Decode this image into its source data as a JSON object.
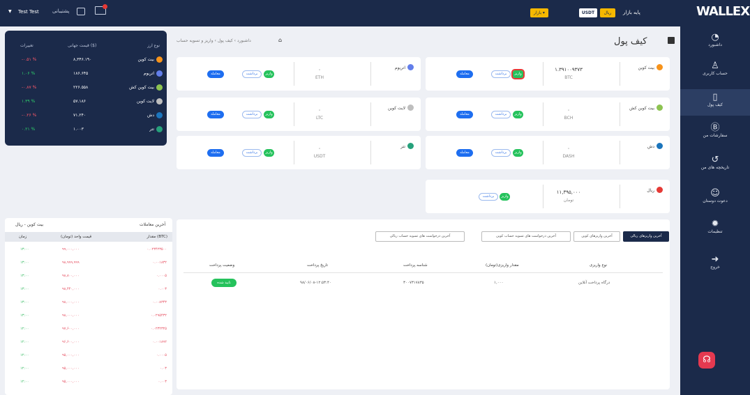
{
  "topbar": {
    "user": "Test Test",
    "support": "پشتیبانی",
    "market_label": "پایه بازار",
    "rial_button": "ریال",
    "usdt_button": "USDT",
    "market_button": "بازار",
    "logo": "WALLEX"
  },
  "nav": [
    {
      "label": "داشبورد",
      "icon": "dashboard-icon"
    },
    {
      "label": "حساب کاربری",
      "icon": "user-icon"
    },
    {
      "label": "کیف پول",
      "icon": "wallet-icon"
    },
    {
      "label": "سفارشات من",
      "icon": "orders-icon"
    },
    {
      "label": "تاریخچه های من",
      "icon": "history-icon"
    },
    {
      "label": "دعوت دوستان",
      "icon": "invite-icon"
    },
    {
      "label": "تنظیمات",
      "icon": "settings-icon"
    },
    {
      "label": "خروج",
      "icon": "logout-icon"
    }
  ],
  "prices": {
    "headers": [
      "نوع ارز",
      "قیمت جهانی ($)",
      "تغییرات"
    ],
    "rows": [
      {
        "name": "بیت کوین",
        "price": "۸,۳۴۶.۱۹۰",
        "change": "-۰.۵۱ %",
        "color": "#f7931a",
        "up": false
      },
      {
        "name": "اتریوم",
        "price": "۱۸۶.۶۴۵",
        "change": "۱.۰۶ %",
        "color": "#627eea",
        "up": true
      },
      {
        "name": "بیت کوین کش",
        "price": "۲۲۶.۵۵۸",
        "change": "-۰.۸۷ %",
        "color": "#8dc351",
        "up": false
      },
      {
        "name": "لایت کوین",
        "price": "۵۷.۱۸۶",
        "change": "۱.۳۹ %",
        "color": "#bebebe",
        "up": true
      },
      {
        "name": "دش",
        "price": "۷۱.۲۴۰",
        "change": "-۰.۲۶ %",
        "color": "#1c75bc",
        "up": false
      },
      {
        "name": "تتر",
        "price": "۱.۰۰۳",
        "change": "۰.۲۱ %",
        "color": "#26a17b",
        "up": true
      }
    ]
  },
  "page": {
    "title": "کیف پول",
    "breadcrumb": "داشبورد  ›  کیف پول  ›  واریز و تسویه حساب"
  },
  "wallets": [
    {
      "name": "بیت کوین",
      "amount": "۱.۳۹۱۰۰۹۳۷۳",
      "unit": "BTC",
      "color": "#f7931a"
    },
    {
      "name": "اتریوم",
      "amount": "۰",
      "unit": "ETH",
      "color": "#627eea"
    },
    {
      "name": "بیت کوین کش",
      "amount": "۰",
      "unit": "BCH",
      "color": "#8dc351"
    },
    {
      "name": "لایت کوین",
      "amount": "۰",
      "unit": "LTC",
      "color": "#bebebe"
    },
    {
      "name": "دش",
      "amount": "۰",
      "unit": "DASH",
      "color": "#1c75bc"
    },
    {
      "name": "تتر",
      "amount": "۰",
      "unit": "USDT",
      "color": "#26a17b"
    },
    {
      "name": "ریال",
      "amount": "۱۱,۳۹۵,۰۰۰",
      "unit": "تومان",
      "color": "#e53935"
    }
  ],
  "wallet_buttons": {
    "deposit": "واریز",
    "withdraw": "برداشت",
    "trade": "معامله"
  },
  "trades": {
    "title": "آخرین معاملات",
    "pair": "بیت کوین - ریال",
    "headers": [
      "مقدار (BTC)",
      "قیمت واحد (تومان)",
      "زمان"
    ],
    "rows": [
      {
        "amount": "۰.۰۲۳۴۲۳۵۰۰",
        "price": "۹۹,۰۰۰,۰۰۰",
        "time": "۱۳:۰۰"
      },
      {
        "amount": "۰.۰۰۱۸۳۲",
        "price": "۹۸,۹۹۹,۹۹۹",
        "time": "۱۳:۰۰"
      },
      {
        "amount": "۰.۰۰۰۵",
        "price": "۹۸,۸۰۰,۰۰۰",
        "time": "۱۳:۰۰"
      },
      {
        "amount": "۰.۰۰۳",
        "price": "۹۸,۴۴۰,۰۰۰",
        "time": "۱۳:۰۰"
      },
      {
        "amount": "۰.۰۰۸۳۴۳",
        "price": "۹۸,۰۰۰,۰۰۰",
        "time": "۱۳:۰۰"
      },
      {
        "amount": "۰.۰۲۹۵۴۳۲",
        "price": "۹۸,۰۰۰,۰۰۰",
        "time": "۱۳:۰۰"
      },
      {
        "amount": "۰.۰۲۳۲۳۲۵",
        "price": "۹۷,۶۰۰,۰۰۰",
        "time": "۱۲:۰۰"
      },
      {
        "amount": "۰.۰۰۱۸۹۲",
        "price": "۹۶,۶۰۰,۰۰۰",
        "time": "۱۲:۰۰"
      },
      {
        "amount": "۰.۰۰۰۵",
        "price": "۹۵,۰۰۰,۰۰۰",
        "time": "۱۲:۰۰"
      },
      {
        "amount": "۰.۰۳",
        "price": "۹۵,۰۰۰,۰۰۰",
        "time": "۱۲:۰۰"
      },
      {
        "amount": "۰.۰۰۳",
        "price": "۹۵,۰۰۰,۰۰۰",
        "time": "۱۲:۰۰"
      }
    ]
  },
  "history": {
    "tabs": [
      "آخرین واریزهای ریالی",
      "آخرین واریزهای کوین",
      "آخرین درخواست های تسویه حساب کوین",
      "آخرین درخواست های تسویه حساب ریالی"
    ],
    "headers": [
      "نوع واریزی",
      "مقدار واریزی(تومان)",
      "شناسه پرداخت",
      "تاریخ پرداخت",
      "وضعیت پرداخت"
    ],
    "row": {
      "type": "درگاه پرداخت آنلاین",
      "amount": "۱,۰۰۰",
      "id": "۳۰۰۷۳۱۷۸۳۵",
      "date": "۹۸/۰۶/۰۸-۱۲:۵۳:۴۰",
      "status": "تایید شده"
    }
  },
  "colors": {
    "navy": "#1b2a4a",
    "green": "#25c25c",
    "blue": "#1e6ef0",
    "red": "#e53935",
    "gold": "#f5b800"
  }
}
